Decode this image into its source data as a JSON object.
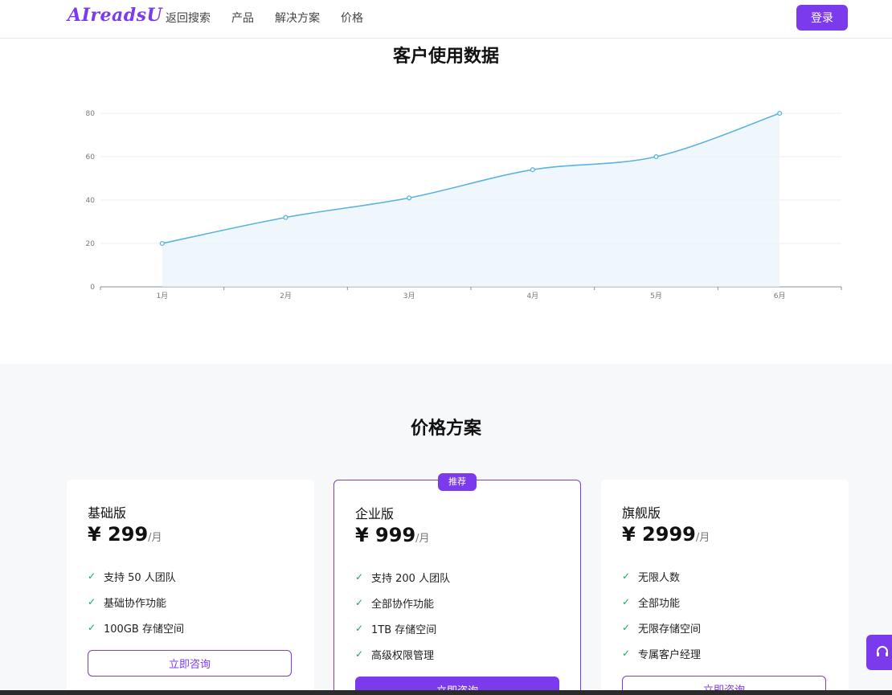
{
  "header": {
    "logo": "AIreadsU",
    "nav": [
      "返回搜索",
      "产品",
      "解决方案",
      "价格"
    ],
    "login": "登录"
  },
  "usage": {
    "title": "客户使用数据"
  },
  "chart_data": {
    "type": "line",
    "categories": [
      "1月",
      "2月",
      "3月",
      "4月",
      "5月",
      "6月"
    ],
    "values": [
      20,
      32,
      41,
      54,
      60,
      80
    ],
    "y_ticks": [
      0,
      20,
      40,
      60,
      80
    ],
    "ylim": [
      0,
      80
    ],
    "grid": true,
    "smooth": true,
    "area_fill": true,
    "line_color": "#5bb3e0",
    "fill_color": "#eaf4fb"
  },
  "pricing": {
    "title": "价格方案",
    "cards": [
      {
        "name": "基础版",
        "price": "¥ 299",
        "period": "/月",
        "features": [
          "支持 50 人团队",
          "基础协作功能",
          "100GB 存储空间"
        ],
        "cta": "立即咨询"
      },
      {
        "name": "企业版",
        "badge": "推荐",
        "price": "¥ 999",
        "period": "/月",
        "features": [
          "支持 200 人团队",
          "全部协作功能",
          "1TB 存储空间",
          "高级权限管理"
        ],
        "cta": "立即咨询"
      },
      {
        "name": "旗舰版",
        "price": "¥ 2999",
        "period": "/月",
        "features": [
          "无限人数",
          "全部功能",
          "无限存储空间",
          "专属客户经理"
        ],
        "cta": "立即咨询"
      }
    ]
  },
  "colors": {
    "accent": "#7c3aed",
    "check": "#22a35a"
  },
  "icons": {
    "check": "check-icon",
    "support": "headset-icon"
  }
}
